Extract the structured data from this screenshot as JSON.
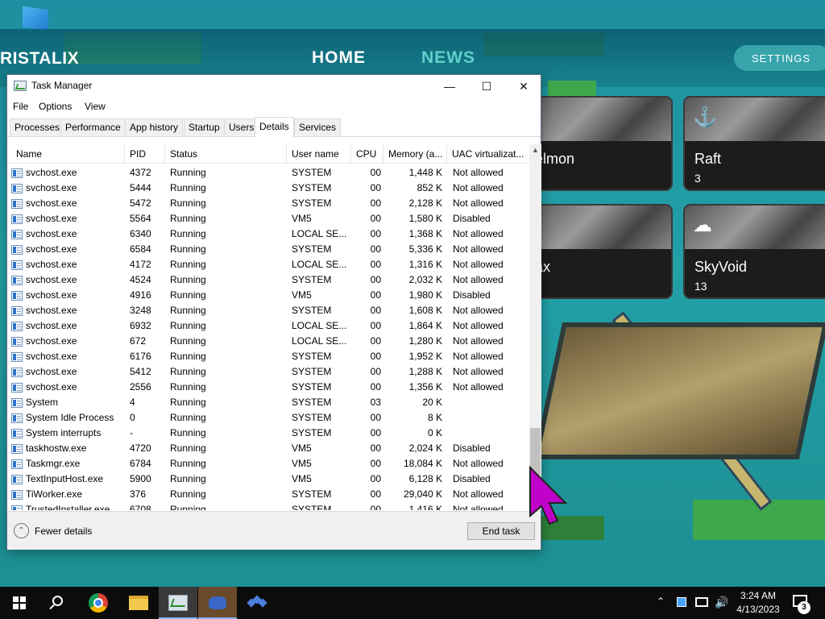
{
  "launcher": {
    "brand": "RISTALIX",
    "nav_home": "HOME",
    "nav_news": "NEWS",
    "settings": "SETTINGS",
    "cards": [
      {
        "name": "elmon",
        "count": ""
      },
      {
        "name": "Raft",
        "count": "3"
      },
      {
        "name": "ax",
        "count": ""
      },
      {
        "name": "SkyVoid",
        "count": "13"
      }
    ]
  },
  "window": {
    "title": "Task Manager",
    "menu": [
      "File",
      "Options",
      "View"
    ],
    "tabs": [
      "Processes",
      "Performance",
      "App history",
      "Startup",
      "Users",
      "Details",
      "Services"
    ],
    "active_tab": "Details",
    "columns": [
      "Name",
      "PID",
      "Status",
      "User name",
      "CPU",
      "Memory (a...",
      "UAC virtualizat..."
    ],
    "rows": [
      [
        "svchost.exe",
        "4372",
        "Running",
        "SYSTEM",
        "00",
        "1,448 K",
        "Not allowed"
      ],
      [
        "svchost.exe",
        "5444",
        "Running",
        "SYSTEM",
        "00",
        "852 K",
        "Not allowed"
      ],
      [
        "svchost.exe",
        "5472",
        "Running",
        "SYSTEM",
        "00",
        "2,128 K",
        "Not allowed"
      ],
      [
        "svchost.exe",
        "5564",
        "Running",
        "VM5",
        "00",
        "1,580 K",
        "Disabled"
      ],
      [
        "svchost.exe",
        "6340",
        "Running",
        "LOCAL SE...",
        "00",
        "1,368 K",
        "Not allowed"
      ],
      [
        "svchost.exe",
        "6584",
        "Running",
        "SYSTEM",
        "00",
        "5,336 K",
        "Not allowed"
      ],
      [
        "svchost.exe",
        "4172",
        "Running",
        "LOCAL SE...",
        "00",
        "1,316 K",
        "Not allowed"
      ],
      [
        "svchost.exe",
        "4524",
        "Running",
        "SYSTEM",
        "00",
        "2,032 K",
        "Not allowed"
      ],
      [
        "svchost.exe",
        "4916",
        "Running",
        "VM5",
        "00",
        "1,980 K",
        "Disabled"
      ],
      [
        "svchost.exe",
        "3248",
        "Running",
        "SYSTEM",
        "00",
        "1,608 K",
        "Not allowed"
      ],
      [
        "svchost.exe",
        "6932",
        "Running",
        "LOCAL SE...",
        "00",
        "1,864 K",
        "Not allowed"
      ],
      [
        "svchost.exe",
        "672",
        "Running",
        "LOCAL SE...",
        "00",
        "1,280 K",
        "Not allowed"
      ],
      [
        "svchost.exe",
        "6176",
        "Running",
        "SYSTEM",
        "00",
        "1,952 K",
        "Not allowed"
      ],
      [
        "svchost.exe",
        "5412",
        "Running",
        "SYSTEM",
        "00",
        "1,288 K",
        "Not allowed"
      ],
      [
        "svchost.exe",
        "2556",
        "Running",
        "SYSTEM",
        "00",
        "1,356 K",
        "Not allowed"
      ],
      [
        "System",
        "4",
        "Running",
        "SYSTEM",
        "03",
        "20 K",
        ""
      ],
      [
        "System Idle Process",
        "0",
        "Running",
        "SYSTEM",
        "00",
        "8 K",
        ""
      ],
      [
        "System interrupts",
        "-",
        "Running",
        "SYSTEM",
        "00",
        "0 K",
        ""
      ],
      [
        "taskhostw.exe",
        "4720",
        "Running",
        "VM5",
        "00",
        "2,024 K",
        "Disabled"
      ],
      [
        "Taskmgr.exe",
        "6784",
        "Running",
        "VM5",
        "00",
        "18,084 K",
        "Not allowed"
      ],
      [
        "TextInputHost.exe",
        "5900",
        "Running",
        "VM5",
        "00",
        "6,128 K",
        "Disabled"
      ],
      [
        "TiWorker.exe",
        "376",
        "Running",
        "SYSTEM",
        "00",
        "29,040 K",
        "Not allowed"
      ],
      [
        "TrustedInstaller.exe",
        "6708",
        "Running",
        "SYSTEM",
        "00",
        "1,416 K",
        "Not allowed"
      ]
    ],
    "fewer_details": "Fewer details",
    "end_task": "End task"
  },
  "taskbar": {
    "time": "3:24 AM",
    "date": "4/13/2023",
    "notification_count": "3"
  },
  "colors": {
    "cursor": "#c000c8",
    "accent": "#8ab4f8"
  }
}
